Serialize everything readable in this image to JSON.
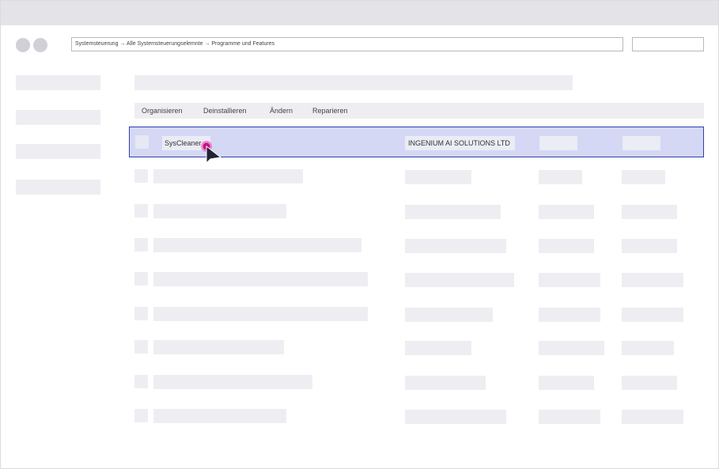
{
  "address_bar": {
    "path": "Systemsteuerung → Alle Systemsteuerungselemnte → Programme und Features"
  },
  "toolbar": {
    "organize_label": "Organisieren",
    "uninstall_label": "Deinstallieren",
    "change_label": "Ändern",
    "repair_label": "Reparieren"
  },
  "selected_program": {
    "name": "SysCleaner",
    "publisher": "INGENIUM AI SOLUTIONS LTD"
  },
  "colors": {
    "selection_fill": "#d4d8f4",
    "selection_border": "#3040a8",
    "cursor_highlight": "#e0109a"
  },
  "icons": {
    "cursor": "mouse-pointer-icon"
  }
}
